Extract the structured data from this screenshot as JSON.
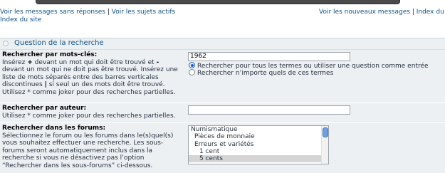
{
  "top_links": {
    "left": [
      "Voir les messages sans réponses",
      "Voir les sujets actifs"
    ],
    "left_second_line": "Index du site",
    "right": [
      "Voir les nouveaux messages",
      "Index du forum"
    ],
    "separator": "|"
  },
  "panel": {
    "title": "Question de la recherche"
  },
  "keywords": {
    "heading": "Rechercher par mots-clés:",
    "help_before_plus": "Insérez ",
    "plus": "+",
    "help_mid": " devant un mot qui doit être trouvé et ",
    "minus": "-",
    "help_after_minus": " devant un mot qui ne doit pas être trouvé. Insérez une liste de mots séparés entre des barres verticales discontinues ",
    "pipe": "|",
    "help_end": " si seul un des mots doit être trouvé. Utilisez * comme joker pour des recherches partielles.",
    "value": "1962",
    "options": [
      {
        "label": "Rechercher pour tous les termes ou utiliser une question comme entrée",
        "checked": true
      },
      {
        "label": "Rechercher n’importe quels de ces termes",
        "checked": false
      }
    ]
  },
  "author": {
    "heading": "Rechercher par auteur:",
    "help": "Utilisez * comme joker pour des recherches partielles.",
    "value": ""
  },
  "forums": {
    "heading": "Rechercher dans les forums:",
    "help": "Sélectionnez le forum ou les forums dans le(s)quel(s) vous souhaitez effectuer une recherche. Les sous-forums seront automatiquement inclus dans la recherche si vous ne désactivez pas l’option “Rechercher dans les sous-forums” ci-dessous.",
    "items": [
      {
        "label": "Numismatique",
        "level": 0,
        "selected": false
      },
      {
        "label": "Pièces de monnaie",
        "level": 1,
        "selected": false
      },
      {
        "label": "Erreurs et variétés",
        "level": 1,
        "selected": false
      },
      {
        "label": "1 cent",
        "level": 2,
        "selected": false
      },
      {
        "label": "5 cents",
        "level": 2,
        "selected": true
      }
    ]
  },
  "colors": {
    "link": "#105289",
    "panel_bg": "#ecf0f3",
    "radio_accent": "#1f5fc9"
  }
}
